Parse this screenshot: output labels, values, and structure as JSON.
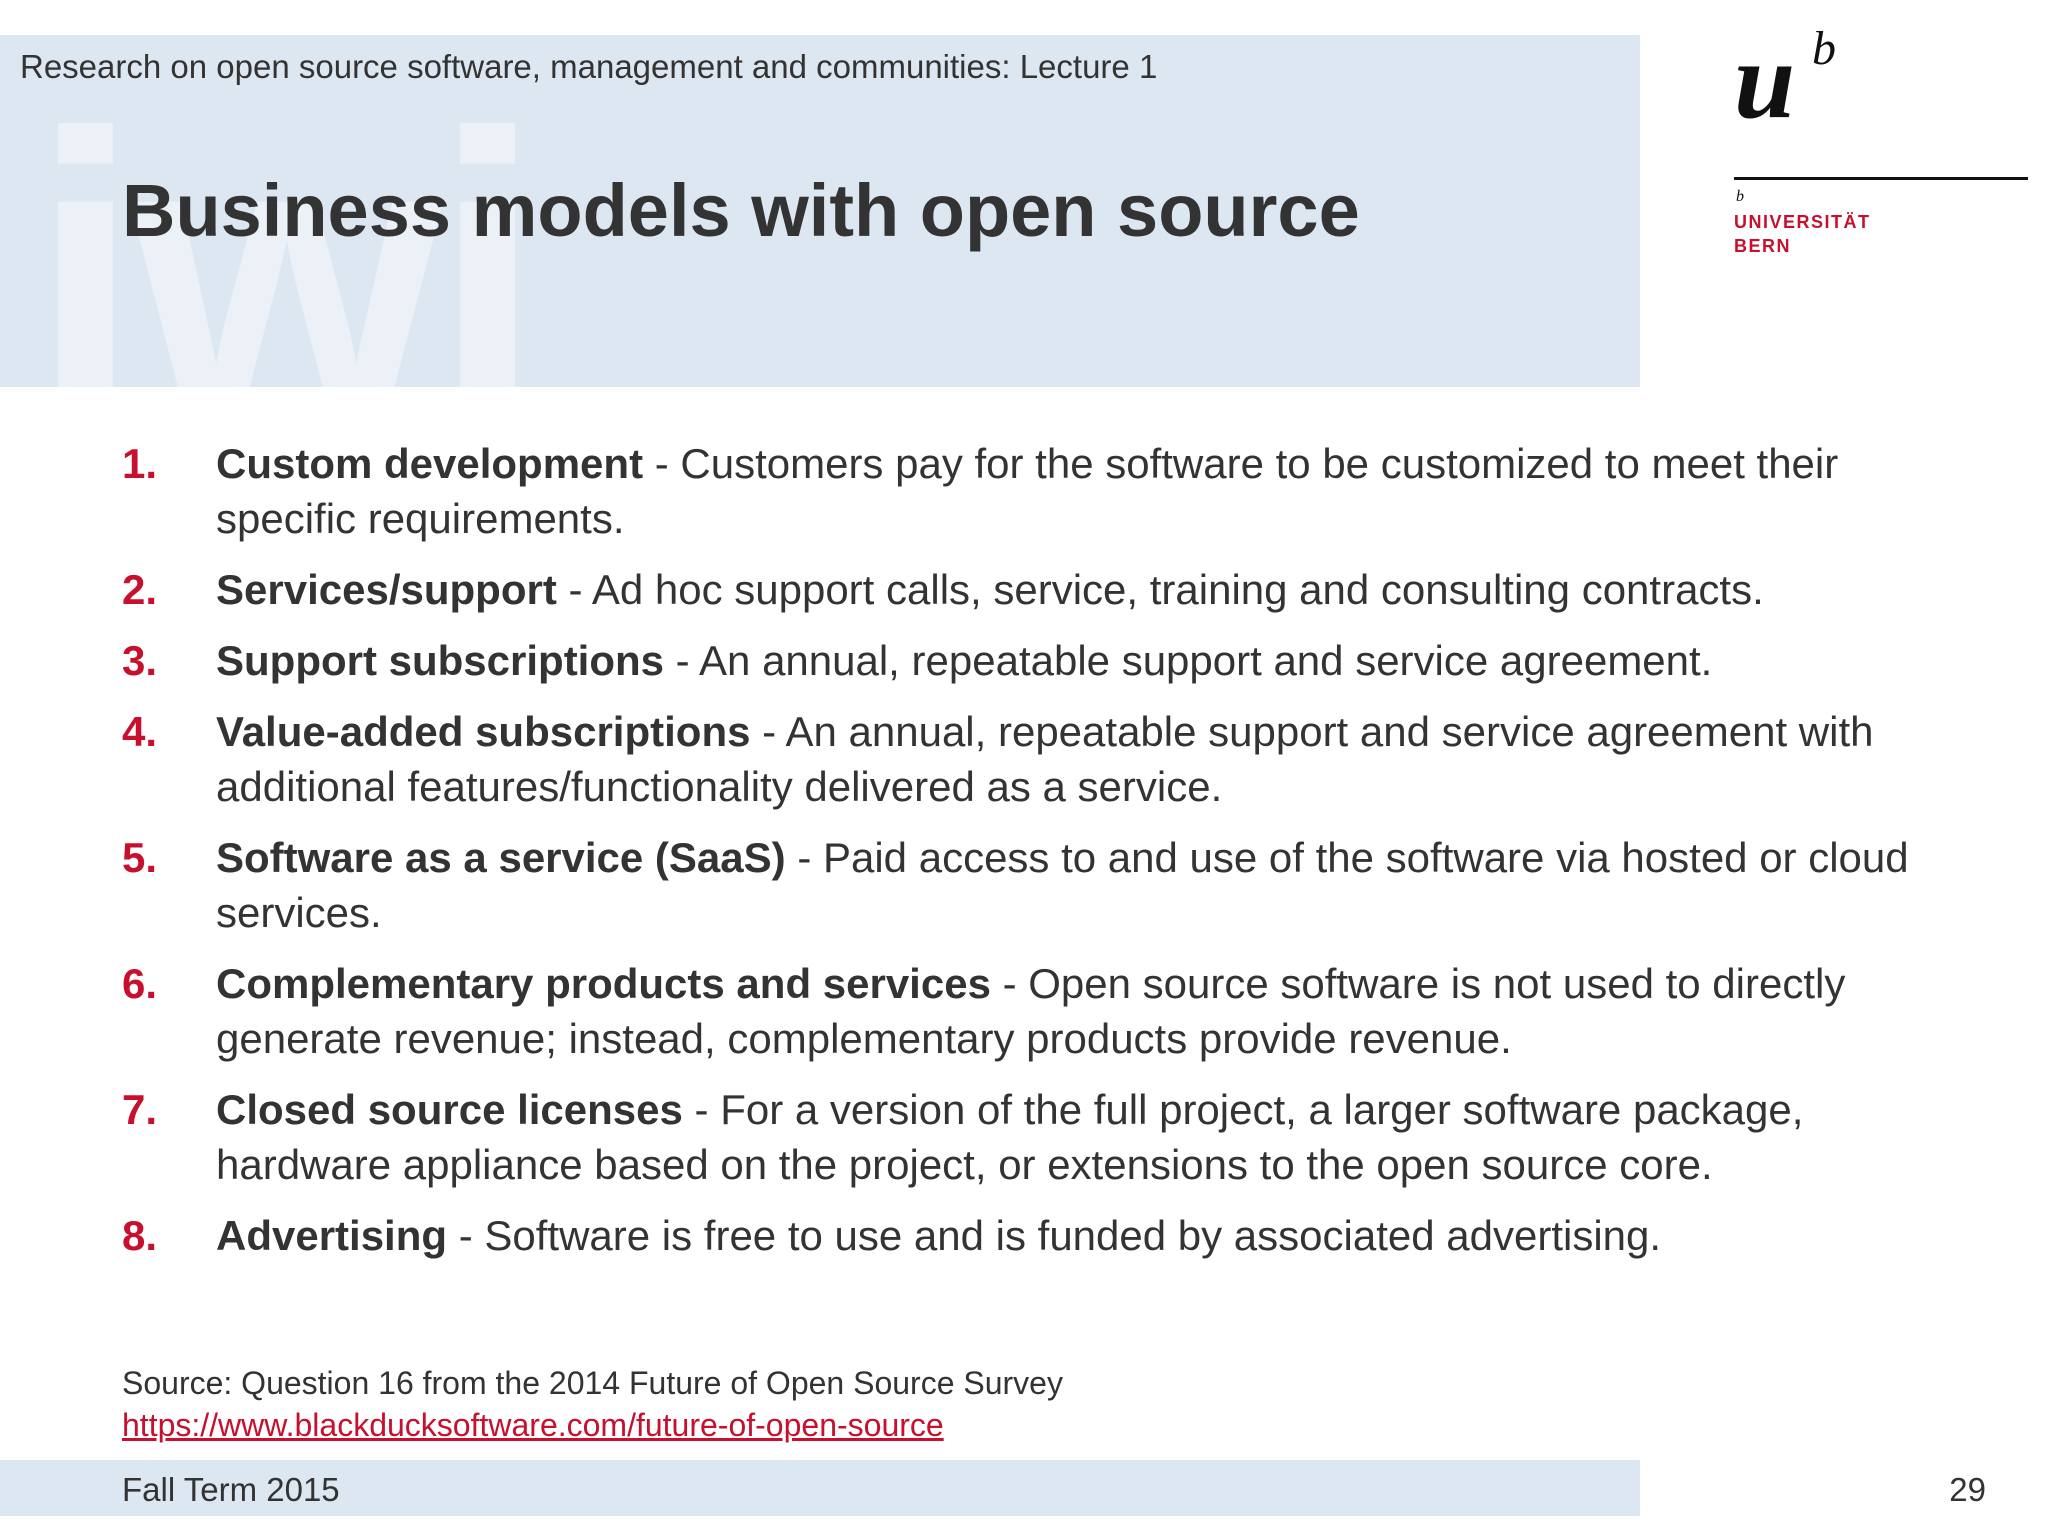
{
  "header": {
    "lecture_title": "Research on open source software, management and communities: Lecture 1",
    "watermark": "iwi",
    "slide_title": "Business models with open source"
  },
  "logo": {
    "line1": "UNIVERSITÄT",
    "line2": "BERN",
    "mark_letter": "u",
    "mark_sup": "b",
    "small_b": "b",
    "accent_color": "#c8102e"
  },
  "items": [
    {
      "num": "1.",
      "term": "Custom development",
      "desc": " - Customers pay for the software to be customized to meet their specific requirements."
    },
    {
      "num": "2.",
      "term": "Services/support",
      "desc": " - Ad hoc support calls, service, training and consulting contracts."
    },
    {
      "num": "3.",
      "term": "Support subscriptions",
      "desc": " - An annual, repeatable support and service agreement."
    },
    {
      "num": "4.",
      "term": "Value-added subscriptions",
      "desc": " - An annual, repeatable support and service agreement with additional features/functionality delivered as a service."
    },
    {
      "num": "5.",
      "term": "Software as a service (SaaS)",
      "desc": " - Paid access to and use of the software via hosted or cloud services."
    },
    {
      "num": "6.",
      "term": "Complementary products and services",
      "desc": " - Open source software is not used to directly generate revenue; instead, complementary products provide revenue."
    },
    {
      "num": "7.",
      "term": "Closed source licenses",
      "desc": " - For a version of the full project, a larger software package, hardware appliance based on the project, or extensions to the open source core."
    },
    {
      "num": "8.",
      "term": "Advertising",
      "desc": " - Software is free to use and is funded by associated advertising."
    }
  ],
  "source": {
    "text": "Source: Question 16 from the 2014 Future of Open Source Survey",
    "link": "https://www.blackducksoftware.com/future-of-open-source"
  },
  "footer": {
    "term": "Fall Term 2015",
    "page": "29"
  },
  "colors": {
    "band": "#dde7f1",
    "accent": "#c8102e",
    "text": "#333333"
  }
}
